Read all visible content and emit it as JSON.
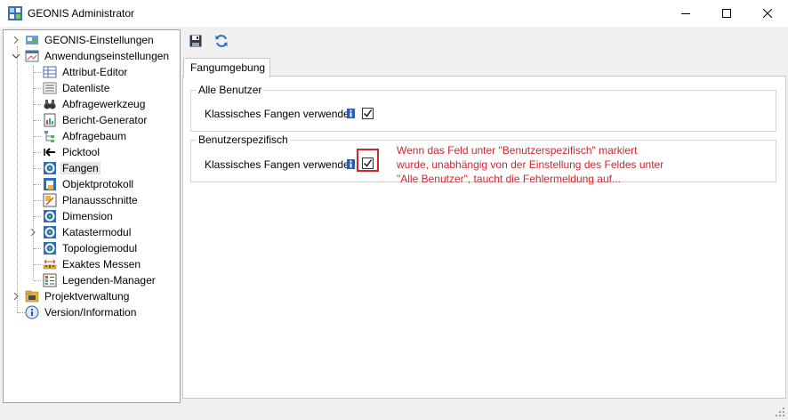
{
  "window": {
    "title": "GEONIS Administrator"
  },
  "toolbar": {
    "save_icon": "save-icon",
    "refresh_icon": "refresh-icon"
  },
  "tree": {
    "items": [
      {
        "label": "GEONIS-Einstellungen",
        "icon": "globe-settings-icon"
      },
      {
        "label": "Anwendungseinstellungen",
        "icon": "app-settings-icon"
      },
      {
        "label": "Attribut-Editor",
        "icon": "grid-icon"
      },
      {
        "label": "Datenliste",
        "icon": "list-icon"
      },
      {
        "label": "Abfragewerkzeug",
        "icon": "binoculars-icon"
      },
      {
        "label": "Bericht-Generator",
        "icon": "report-icon"
      },
      {
        "label": "Abfragebaum",
        "icon": "query-tree-icon"
      },
      {
        "label": "Picktool",
        "icon": "pick-arrow-icon"
      },
      {
        "label": "Fangen",
        "icon": "snap-icon"
      },
      {
        "label": "Objektprotokoll",
        "icon": "object-log-icon"
      },
      {
        "label": "Planausschnitte",
        "icon": "plan-icon"
      },
      {
        "label": "Dimension",
        "icon": "snap-icon"
      },
      {
        "label": "Katastermodul",
        "icon": "snap-icon"
      },
      {
        "label": "Topologiemodul",
        "icon": "snap-icon"
      },
      {
        "label": "Exaktes Messen",
        "icon": "measure-icon"
      },
      {
        "label": "Legenden-Manager",
        "icon": "legend-icon"
      },
      {
        "label": "Projektverwaltung",
        "icon": "project-icon"
      },
      {
        "label": "Version/Information",
        "icon": "info-icon"
      }
    ],
    "selected": "Fangen"
  },
  "tab": {
    "label": "Fangumgebung"
  },
  "groups": {
    "all_users": {
      "title": "Alle Benutzer",
      "row_label": "Klassisches Fangen verwenden",
      "checked": true
    },
    "user_specific": {
      "title": "Benutzerspezifisch",
      "row_label": "Klassisches Fangen verwenden",
      "checked": true
    }
  },
  "annotation": {
    "lines": [
      "Wenn das Feld unter \"Benutzerspezifisch\" markiert",
      "wurde, unabhängig von der Einstellung des Feldes unter",
      "\"Alle Benutzer\", taucht die Fehlermeldung auf..."
    ]
  },
  "colors": {
    "annotation": "#d0262b",
    "selection": "#e5e5e5",
    "info_icon": "#2a5db0"
  }
}
